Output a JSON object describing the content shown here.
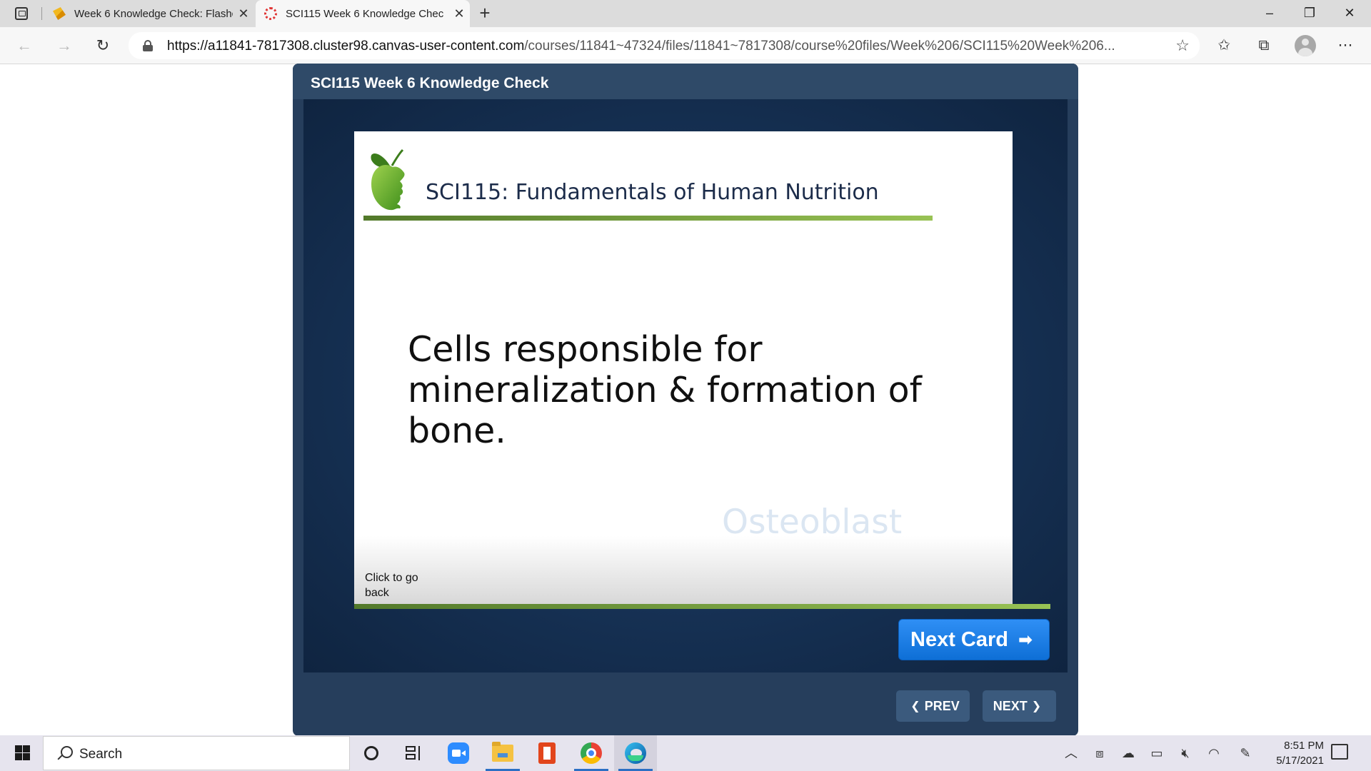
{
  "browser": {
    "tabs": [
      {
        "title": "Week 6 Knowledge Check: Flashc",
        "active": false
      },
      {
        "title": "SCI115 Week 6 Knowledge Chec",
        "active": true
      }
    ],
    "url_host": "https://a11841-7817308.cluster98.canvas-user-content.com",
    "url_path": "/courses/11841~47324/files/11841~7817308/course%20files/Week%206/SCI115%20Week%206..."
  },
  "viewer": {
    "title": "SCI115 Week 6 Knowledge Check",
    "card": {
      "course_title": "SCI115: Fundamentals of Human Nutrition",
      "question": "Cells responsible for mineralization & formation of bone.",
      "answer_hint": "Osteoblast",
      "go_back": "Click to go back"
    },
    "next_card_label": "Next Card",
    "prev_label": "PREV",
    "next_label": "NEXT"
  },
  "taskbar": {
    "search_placeholder": "Search",
    "time": "8:51 PM",
    "date": "5/17/2021"
  },
  "colors": {
    "viewer_bg": "#263e5c",
    "accent_green": "#98c254",
    "next_card_blue": "#0e6fd6"
  }
}
